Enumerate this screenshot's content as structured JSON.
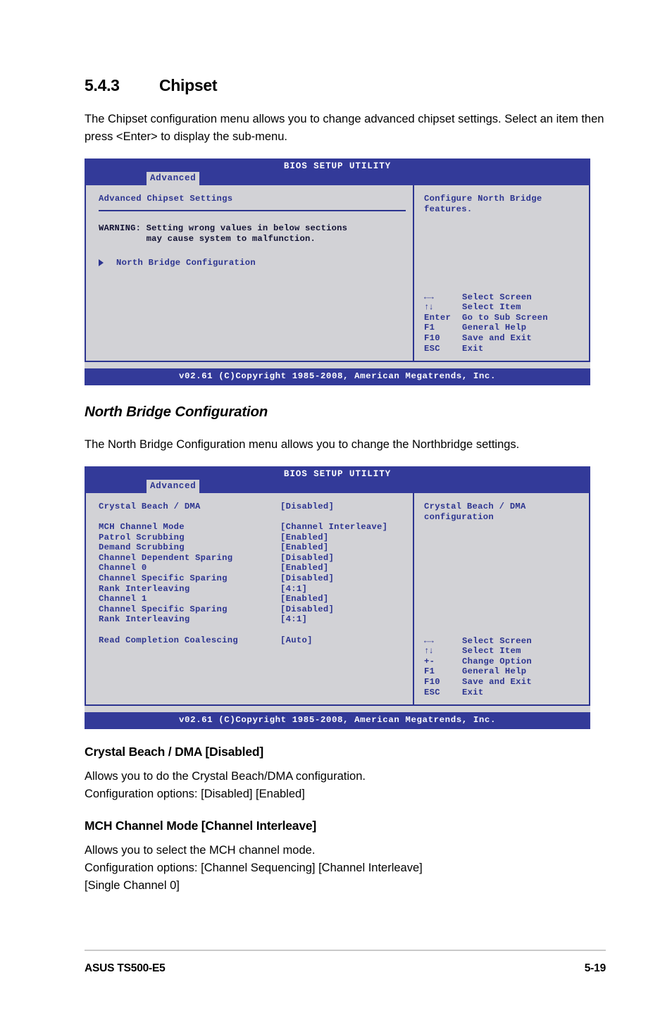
{
  "section": {
    "number": "5.4.3",
    "title": "Chipset",
    "intro": "The Chipset configuration menu allows you to change advanced chipset settings. Select an item then press <Enter> to display the sub-menu."
  },
  "bios_screen_1": {
    "title": "BIOS SETUP UTILITY",
    "tab": "Advanced",
    "panel_title": "Advanced Chipset Settings",
    "warning": "WARNING: Setting wrong values in below sections\n         may cause system to malfunction.",
    "submenu_item": "North Bridge Configuration",
    "help": "Configure North Bridge features.",
    "legend": [
      {
        "key": "←→",
        "action": "Select Screen"
      },
      {
        "key": "↑↓",
        "action": "Select Item"
      },
      {
        "key": "Enter",
        "action": "Go to Sub Screen"
      },
      {
        "key": "F1",
        "action": "General Help"
      },
      {
        "key": "F10",
        "action": "Save and Exit"
      },
      {
        "key": "ESC",
        "action": "Exit"
      }
    ],
    "footer": "v02.61 (C)Copyright 1985-2008, American Megatrends, Inc."
  },
  "north_bridge": {
    "heading": "North Bridge Configuration",
    "intro": "The North Bridge Configuration menu allows you to change the Northbridge settings."
  },
  "bios_screen_2": {
    "title": "BIOS SETUP UTILITY",
    "tab": "Advanced",
    "help": "Crystal Beach / DMA\nconfiguration",
    "settings": [
      {
        "name": "Crystal Beach / DMA",
        "value": "[Disabled]"
      },
      {
        "name": "",
        "value": ""
      },
      {
        "name": "MCH Channel Mode",
        "value": "[Channel Interleave]"
      },
      {
        "name": "Patrol Scrubbing",
        "value": "[Enabled]"
      },
      {
        "name": "Demand Scrubbing",
        "value": "[Enabled]"
      },
      {
        "name": "Channel Dependent Sparing",
        "value": "[Disabled]"
      },
      {
        "name": "Channel 0",
        "value": "[Enabled]"
      },
      {
        "name": "Channel Specific Sparing",
        "value": "[Disabled]"
      },
      {
        "name": "Rank Interleaving",
        "value": "[4:1]"
      },
      {
        "name": "Channel 1",
        "value": "[Enabled]"
      },
      {
        "name": "Channel Specific Sparing",
        "value": "[Disabled]"
      },
      {
        "name": "Rank Interleaving",
        "value": "[4:1]"
      },
      {
        "name": "",
        "value": ""
      },
      {
        "name": "Read Completion Coalescing",
        "value": "[Auto]"
      }
    ],
    "legend": [
      {
        "key": "←→",
        "action": "Select Screen"
      },
      {
        "key": "↑↓",
        "action": "Select Item"
      },
      {
        "key": "+-",
        "action": "Change Option"
      },
      {
        "key": "F1",
        "action": "General Help"
      },
      {
        "key": "F10",
        "action": "Save and Exit"
      },
      {
        "key": "ESC",
        "action": "Exit"
      }
    ],
    "footer": "v02.61 (C)Copyright 1985-2008, American Megatrends, Inc."
  },
  "options": [
    {
      "heading": "Crystal Beach / DMA [Disabled]",
      "lines": [
        "Allows you to do the Crystal Beach/DMA configuration.",
        "Configuration options: [Disabled] [Enabled]"
      ]
    },
    {
      "heading": "MCH Channel Mode [Channel Interleave]",
      "lines": [
        "Allows you to select the MCH channel mode.",
        "Configuration options: [Channel Sequencing] [Channel Interleave]",
        "[Single Channel 0]"
      ]
    }
  ],
  "page_footer": {
    "left": "ASUS TS500-E5",
    "right": "5-19"
  },
  "colors": {
    "bios_header": "#333a99",
    "bios_text": "#2c3490",
    "bios_bg": "#d2d2d6"
  }
}
